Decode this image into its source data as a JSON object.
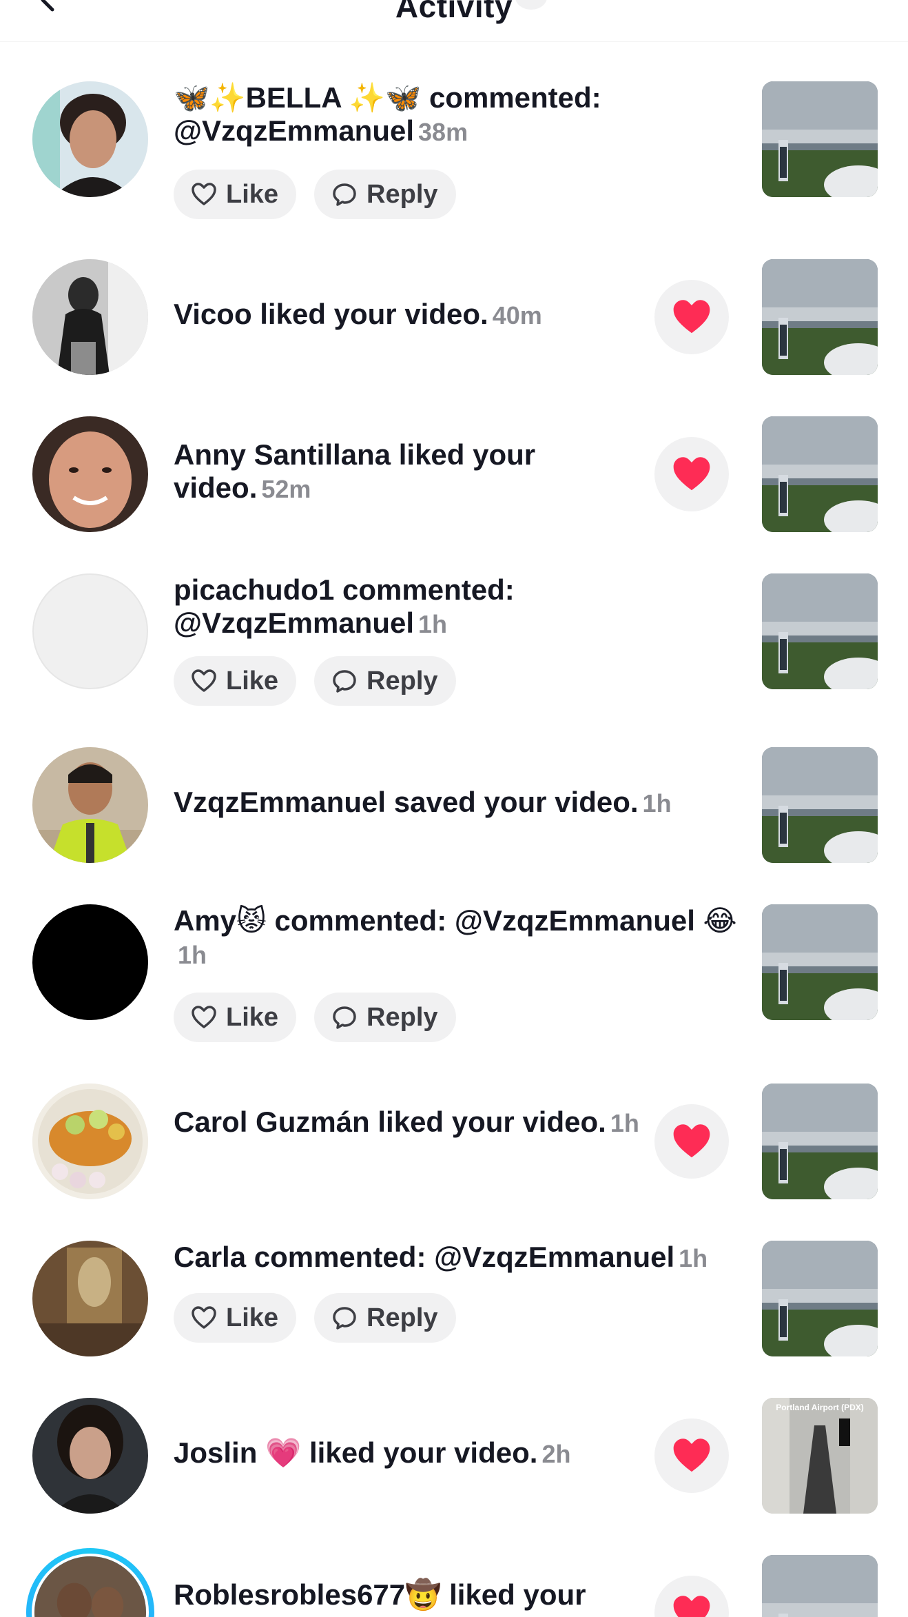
{
  "header": {
    "title": "Activity",
    "back_icon": "chevron-left-icon"
  },
  "labels": {
    "like": "Like",
    "reply": "Reply"
  },
  "colors": {
    "heart": "#fe2c55",
    "pill_bg": "#f1f1f2",
    "time_text": "#8a8b91",
    "ring": "#1ec8f5"
  },
  "notifications": [
    {
      "type": "comment",
      "text": "🦋✨BELLA ✨🦋 commented: @VzqzEmmanuel",
      "time": "38m"
    },
    {
      "type": "like",
      "text": "Vicoo liked your video.",
      "time": "40m"
    },
    {
      "type": "like",
      "text": "Anny Santillana liked your video.",
      "time": "52m"
    },
    {
      "type": "comment",
      "text": "picachudo1 commented: @VzqzEmmanuel",
      "time": "1h"
    },
    {
      "type": "save",
      "text": "VzqzEmmanuel saved your video.",
      "time": "1h"
    },
    {
      "type": "comment",
      "text": "Amy😾 commented: @VzqzEmmanuel 😂",
      "time": "1h"
    },
    {
      "type": "like",
      "text": "Carol Guzmán liked your video.",
      "time": "1h"
    },
    {
      "type": "comment",
      "text": "Carla commented: @VzqzEmmanuel",
      "time": "1h"
    },
    {
      "type": "like",
      "text": "Joslin 💗 liked your video.",
      "time": "2h"
    },
    {
      "type": "like",
      "text": "Roblesrobles677🤠 liked your",
      "time": ""
    }
  ],
  "thumb_caption": "Portland Airport (PDX)"
}
